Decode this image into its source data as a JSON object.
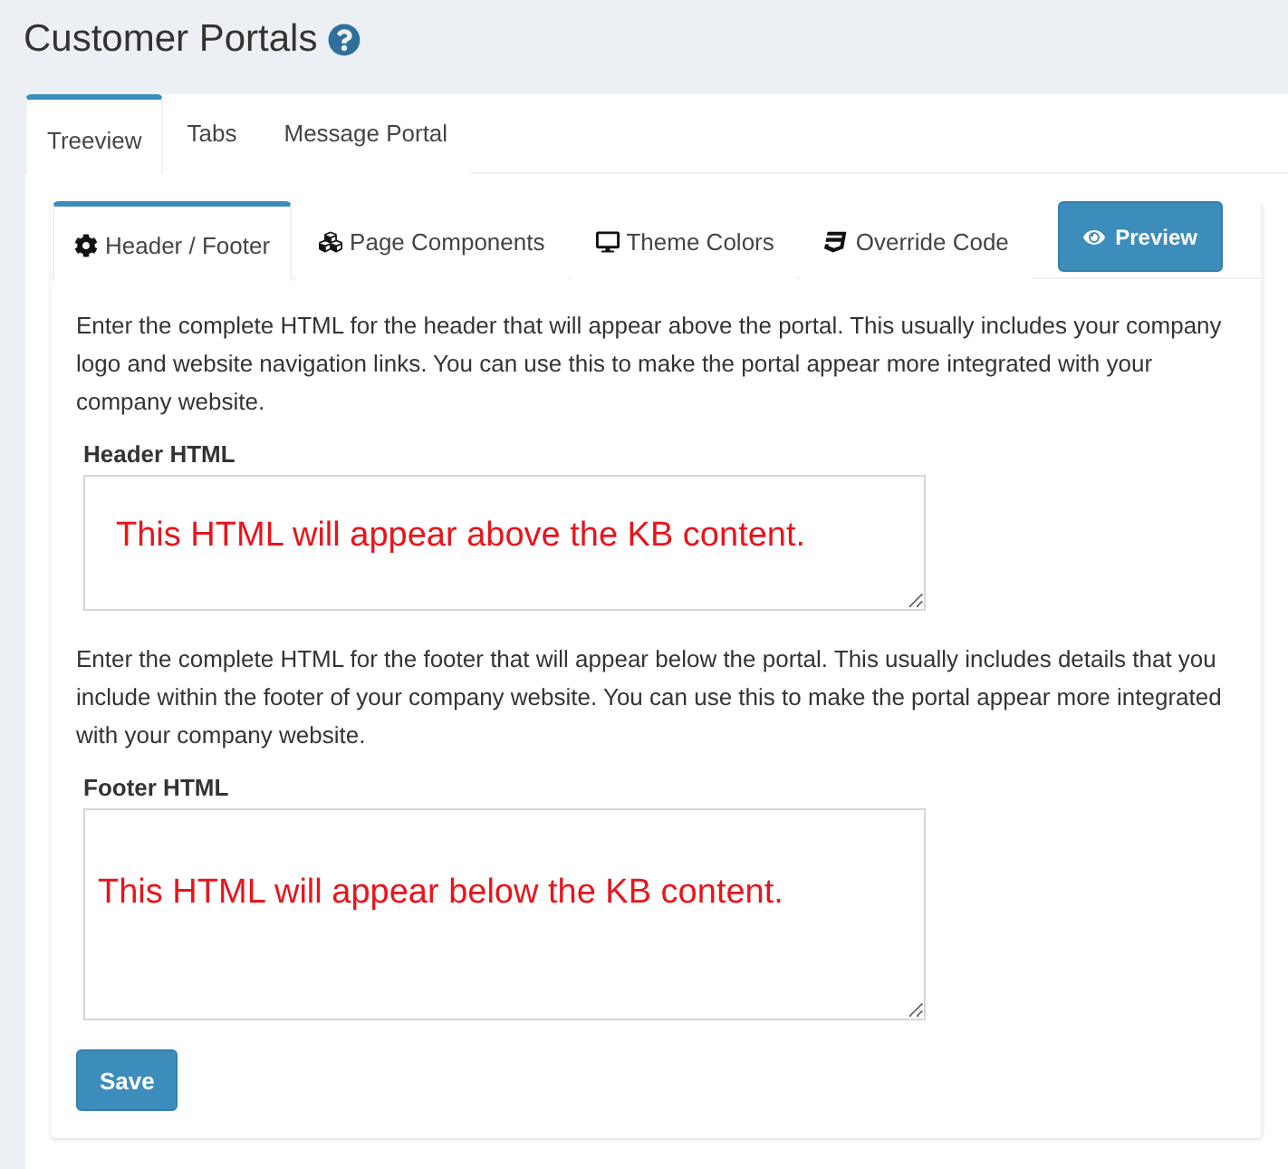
{
  "page": {
    "title": "Customer Portals"
  },
  "tabs": [
    {
      "label": "Treeview",
      "selected": true
    },
    {
      "label": "Tabs",
      "selected": false
    },
    {
      "label": "Message Portal",
      "selected": false
    }
  ],
  "subtabs": [
    {
      "label": "Header / Footer",
      "selected": true
    },
    {
      "label": "Page Components",
      "selected": false
    },
    {
      "label": "Theme Colors",
      "selected": false
    },
    {
      "label": "Override Code",
      "selected": false
    }
  ],
  "preview_button": {
    "label": "Preview"
  },
  "sections": [
    {
      "description": "Enter the complete HTML for the header that will appear above the portal. This usually includes your company logo and website navigation links. You can use this to make the portal appear more integrated with your company website.",
      "label": "Header HTML",
      "value": "This HTML will appear above the KB content."
    },
    {
      "description": "Enter the complete HTML for the footer that will appear below the portal. This usually includes details that you include within the footer of your company website. You can use this to make the portal appear more integrated with your company website.",
      "label": "Footer HTML",
      "value": "This HTML will appear below the KB content."
    }
  ],
  "save_button": {
    "label": "Save"
  }
}
